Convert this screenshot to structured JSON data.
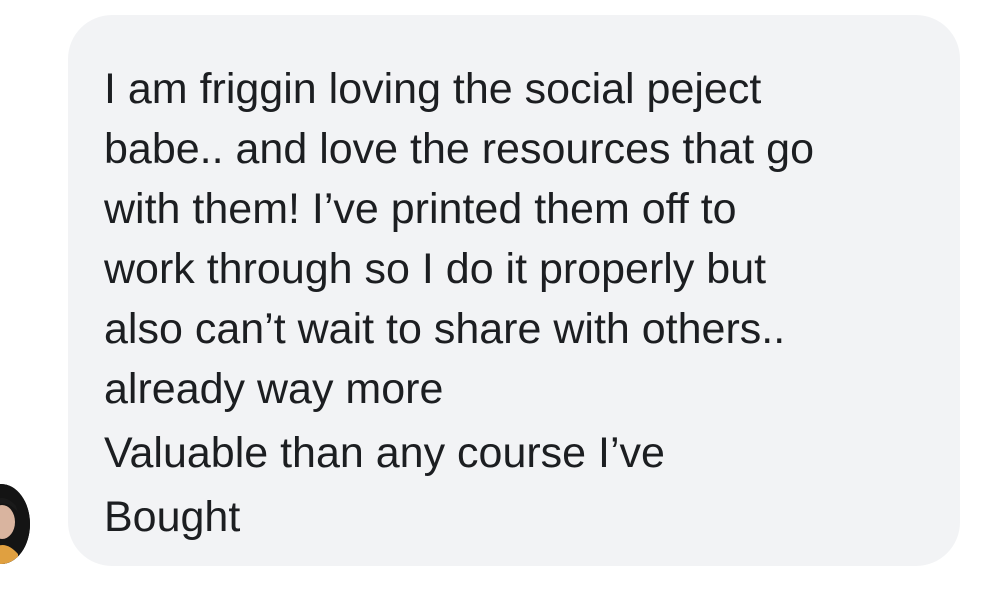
{
  "message": {
    "lines": [
      "I am friggin loving the social peject",
      "babe.. and love the resources that go",
      "with them! I’ve printed them off to",
      "work through so I do it properly but",
      "also can’t wait to share with others..",
      "already way more",
      "Valuable than any  course I’ve",
      "Bought"
    ]
  },
  "icons": {
    "avatar": "profile-photo"
  },
  "colors": {
    "bubble_background": "#f2f3f5",
    "text": "#1c1e21",
    "page_background": "#ffffff"
  }
}
